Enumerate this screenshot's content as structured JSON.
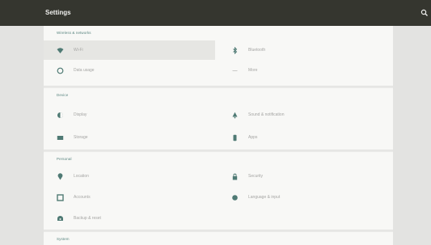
{
  "header": {
    "title": "Settings",
    "search_icon": "search-icon"
  },
  "sections": [
    {
      "title": "Wireless & networks",
      "left": [
        {
          "label": "Wi-Fi",
          "icon": "wifi-icon",
          "selected": true
        },
        {
          "label": "Data usage",
          "icon": "data-usage-icon"
        }
      ],
      "right": [
        {
          "label": "Bluetooth",
          "icon": "bluetooth-icon"
        },
        {
          "label": "More",
          "icon": "more-icon"
        }
      ]
    },
    {
      "title": "Device",
      "left": [
        {
          "label": "Display",
          "icon": "display-icon"
        },
        {
          "label": "Storage",
          "icon": "storage-icon"
        }
      ],
      "right": [
        {
          "label": "Sound & notification",
          "icon": "bell-icon"
        },
        {
          "label": "Apps",
          "icon": "apps-icon"
        }
      ]
    },
    {
      "title": "Personal",
      "left": [
        {
          "label": "Location",
          "icon": "location-icon"
        },
        {
          "label": "Accounts",
          "icon": "accounts-icon"
        },
        {
          "label": "Backup & reset",
          "icon": "backup-icon"
        }
      ],
      "right": [
        {
          "label": "Security",
          "icon": "lock-icon"
        },
        {
          "label": "Language & input",
          "icon": "globe-icon"
        }
      ]
    },
    {
      "title": "System"
    }
  ],
  "colors": {
    "topbar": "#35362f",
    "accent": "#58847f",
    "icon": "#4f7a74",
    "text": "#a5a5a3"
  }
}
